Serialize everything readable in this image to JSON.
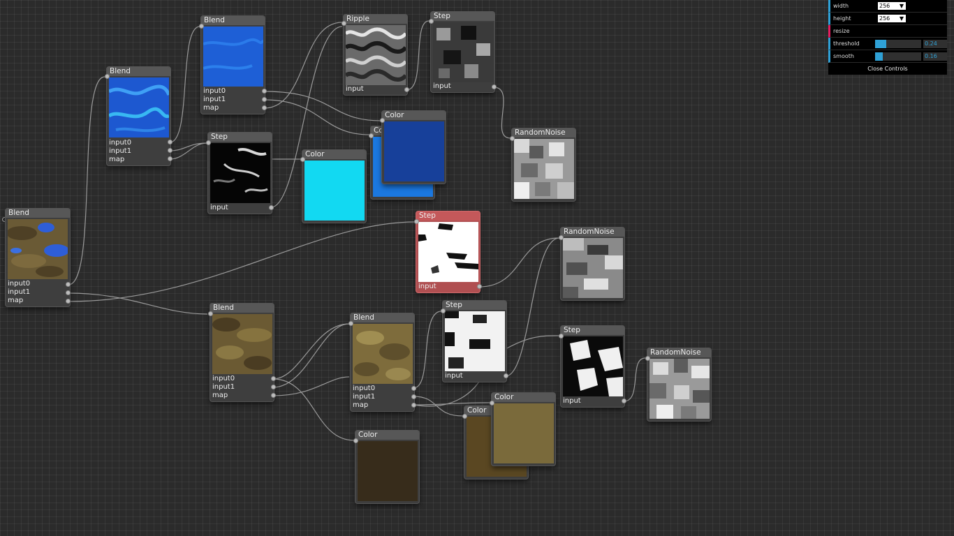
{
  "nodes": {
    "blend_main": {
      "title": "Blend",
      "ports": [
        "input0",
        "input1",
        "map"
      ]
    },
    "blend_blue1": {
      "title": "Blend",
      "ports": [
        "input0",
        "input1",
        "map"
      ]
    },
    "blend_blue2": {
      "title": "Blend",
      "ports": [
        "input0",
        "input1",
        "map"
      ]
    },
    "step_blue": {
      "title": "Step",
      "ports": [
        "input"
      ]
    },
    "color_cyan": {
      "title": "Color",
      "color": "#12d9f2"
    },
    "ripple": {
      "title": "Ripple",
      "ports": [
        "input"
      ]
    },
    "step_top": {
      "title": "Step",
      "ports": [
        "input"
      ]
    },
    "color_blue_back": {
      "title": "Co",
      "color": "#1b78e0"
    },
    "color_blue_front": {
      "title": "Color",
      "color": "#17409a"
    },
    "randomnoise_top": {
      "title": "RandomNoise"
    },
    "step_selected": {
      "title": "Step",
      "ports": [
        "input"
      ]
    },
    "randomnoise_mid": {
      "title": "RandomNoise"
    },
    "blend_brown1": {
      "title": "Blend",
      "ports": [
        "input0",
        "input1",
        "map"
      ]
    },
    "blend_brown2": {
      "title": "Blend",
      "ports": [
        "input0",
        "input1",
        "map"
      ]
    },
    "step_mid": {
      "title": "Step",
      "ports": [
        "input"
      ]
    },
    "step_low": {
      "title": "Step",
      "ports": [
        "input"
      ]
    },
    "randomnoise_low": {
      "title": "RandomNoise"
    },
    "color_dark": {
      "title": "Color",
      "color": "#372c1b"
    },
    "color_brown_back": {
      "title": "Color",
      "color": "#5a4722"
    },
    "color_olive_front": {
      "title": "Color",
      "color": "#7a6a3b"
    }
  },
  "controls": {
    "width_label": "width",
    "width_value": "256",
    "height_label": "height",
    "height_value": "256",
    "resize_label": "resize",
    "threshold_label": "threshold",
    "threshold_value": "0.24",
    "threshold_level": 0.24,
    "smooth_label": "smooth",
    "smooth_value": "0.16",
    "smooth_level": 0.16,
    "close_label": "Close Controls",
    "accent_color": "#2fa1d6",
    "function_color": "#e61d5f"
  }
}
